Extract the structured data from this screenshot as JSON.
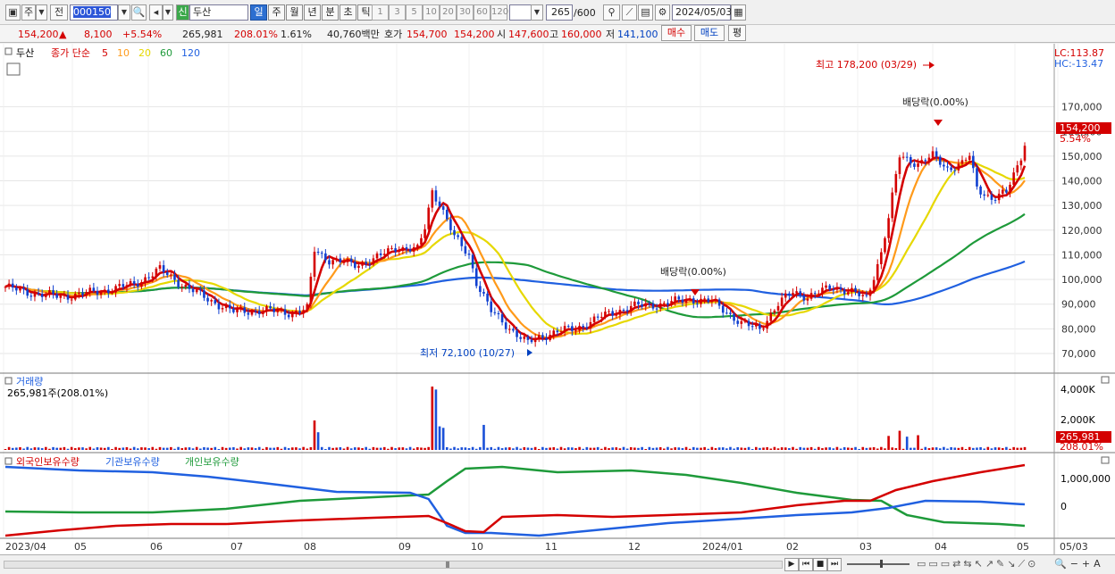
{
  "toolbar": {
    "period": "주",
    "prev": "전",
    "code": "000150",
    "new_badge": "신",
    "name": "두산",
    "timeframes": [
      "일",
      "주",
      "월",
      "년",
      "분",
      "초",
      "틱"
    ],
    "active_tf": "일",
    "intervals": [
      "1",
      "3",
      "5",
      "10",
      "20",
      "30",
      "60",
      "120"
    ],
    "count": "265",
    "count_max": "/600",
    "date": "2024/05/03"
  },
  "quote": {
    "price": "154,200",
    "arrow": "▲",
    "change": "8,100",
    "pct": "+5.54%",
    "volume": "265,981",
    "vol_ratio": "208.01%",
    "turnover": "1.61%",
    "amount": "40,760백만",
    "ask_label": "호가",
    "ask": "154,700",
    "bid": "154,200",
    "open_label": "시",
    "open": "147,600",
    "high_label": "고",
    "high": "160,000",
    "low_label": "저",
    "low": "141,100",
    "buy_label": "매수",
    "sell_label": "매도",
    "eval_label": "평"
  },
  "legend": {
    "name": "두산",
    "ma_label": "종가 단순",
    "ma": [
      {
        "p": "5",
        "color": "#d40000"
      },
      {
        "p": "10",
        "color": "#ff9a1a"
      },
      {
        "p": "20",
        "color": "#e6d800"
      },
      {
        "p": "60",
        "color": "#1e9a3a"
      },
      {
        "p": "120",
        "color": "#2060e0"
      }
    ],
    "lc": "LC:113.87",
    "hc": "HC:-13.47"
  },
  "annotations": {
    "high": "최고 178,200 (03/29)",
    "low": "최저 72,100 (10/27)",
    "div1": "배당락(0.00%)",
    "div2": "배당락(0.00%)"
  },
  "price_tag": {
    "value": "154,200",
    "pct": "5.54%"
  },
  "volume": {
    "title": "거래량",
    "current": "265,981주(208.01%)",
    "tag": "265,981",
    "tag_pct": "208.01%",
    "axis": [
      "4,000K",
      "2,000K"
    ]
  },
  "holdings": {
    "labels": [
      "외국인보유수량",
      "기관보유수량",
      "개인보유수량"
    ],
    "colors": [
      "#d40000",
      "#2060e0",
      "#1e9a3a"
    ],
    "axis": [
      "1,000,000",
      "0"
    ]
  },
  "xaxis": [
    "2023/04",
    "05",
    "06",
    "07",
    "08",
    "09",
    "10",
    "11",
    "12",
    "2024/01",
    "02",
    "03",
    "04",
    "05",
    "05/03"
  ],
  "chart_data": {
    "type": "candlestick",
    "ylim": [
      66000,
      178200
    ],
    "yticks": [
      70000,
      80000,
      90000,
      100000,
      110000,
      120000,
      130000,
      140000,
      150000,
      160000,
      170000
    ],
    "ytick_labels": [
      "70,000",
      "80,000",
      "90,000",
      "100,000",
      "110,000",
      "120,000",
      "130,000",
      "140,000",
      "150,000",
      "160,000",
      "170,000"
    ],
    "close_anchors": [
      [
        0,
        97000
      ],
      [
        5,
        95000
      ],
      [
        15,
        93000
      ],
      [
        25,
        95000
      ],
      [
        35,
        98000
      ],
      [
        42,
        104000
      ],
      [
        48,
        98000
      ],
      [
        55,
        92000
      ],
      [
        62,
        87000
      ],
      [
        70,
        87500
      ],
      [
        78,
        86500
      ],
      [
        82,
        88000
      ],
      [
        84,
        112000
      ],
      [
        88,
        108000
      ],
      [
        95,
        106000
      ],
      [
        100,
        108000
      ],
      [
        106,
        113000
      ],
      [
        112,
        112000
      ],
      [
        114,
        121000
      ],
      [
        116,
        136000
      ],
      [
        118,
        131000
      ],
      [
        122,
        117000
      ],
      [
        126,
        110000
      ],
      [
        128,
        99000
      ],
      [
        132,
        87000
      ],
      [
        138,
        79000
      ],
      [
        142,
        74000
      ],
      [
        144,
        76000
      ],
      [
        150,
        79000
      ],
      [
        155,
        80000
      ],
      [
        162,
        85000
      ],
      [
        170,
        89000
      ],
      [
        178,
        90000
      ],
      [
        186,
        92000
      ],
      [
        192,
        91000
      ],
      [
        196,
        87000
      ],
      [
        200,
        82000
      ],
      [
        205,
        80000
      ],
      [
        210,
        90000
      ],
      [
        214,
        95000
      ],
      [
        218,
        93000
      ],
      [
        225,
        97000
      ],
      [
        230,
        95000
      ],
      [
        234,
        92000
      ],
      [
        238,
        111000
      ],
      [
        240,
        125000
      ],
      [
        243,
        150000
      ],
      [
        248,
        147000
      ],
      [
        252,
        150000
      ],
      [
        256,
        145000
      ],
      [
        260,
        147000
      ],
      [
        262,
        150000
      ],
      [
        264,
        137000
      ],
      [
        268,
        133000
      ],
      [
        272,
        135000
      ],
      [
        275,
        146000
      ],
      [
        277,
        154200
      ]
    ],
    "volume_spikes": [
      [
        84,
        2000
      ],
      [
        85,
        1200
      ],
      [
        116,
        4300
      ],
      [
        117,
        4100
      ],
      [
        118,
        1600
      ],
      [
        119,
        1500
      ],
      [
        130,
        1700
      ],
      [
        240,
        950
      ],
      [
        243,
        1300
      ],
      [
        245,
        900
      ],
      [
        248,
        1000
      ]
    ]
  }
}
